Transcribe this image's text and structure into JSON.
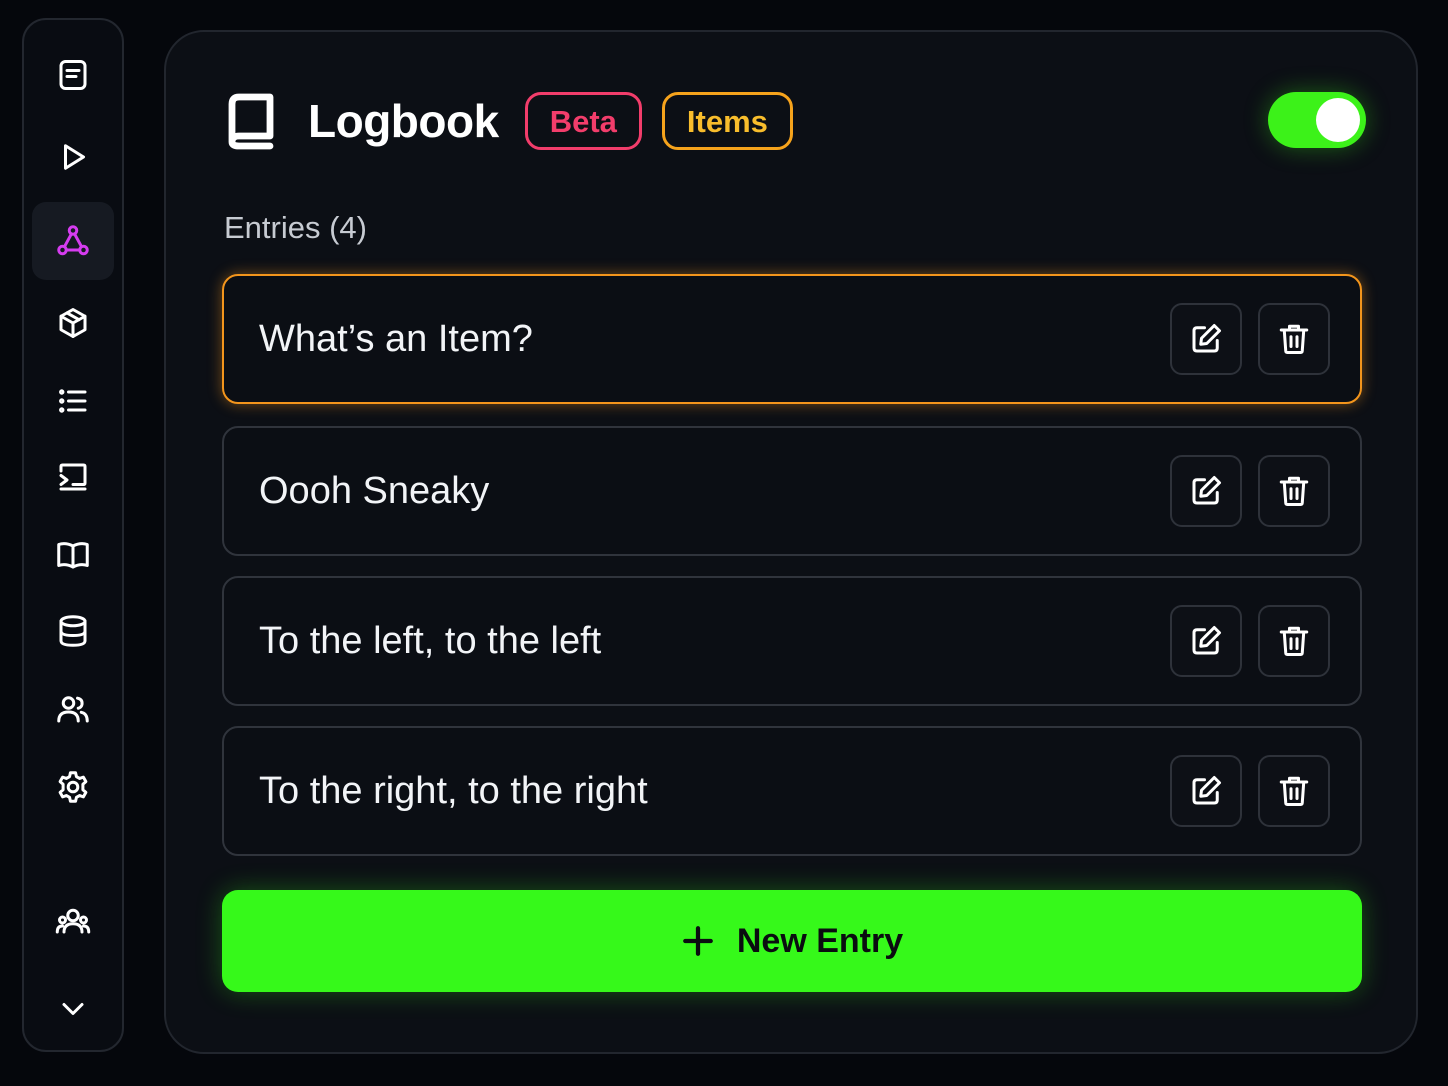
{
  "sidebar": {
    "items": [
      {
        "icon": "notes-icon",
        "active": false
      },
      {
        "icon": "play-icon",
        "active": false
      },
      {
        "icon": "nodes-icon",
        "active": true
      },
      {
        "icon": "cube-icon",
        "active": false
      },
      {
        "icon": "list-icon",
        "active": false
      },
      {
        "icon": "terminal-screen-icon",
        "active": false
      },
      {
        "icon": "open-book-icon",
        "active": false
      },
      {
        "icon": "database-icon",
        "active": false
      },
      {
        "icon": "users-icon",
        "active": false
      },
      {
        "icon": "gear-icon",
        "active": false
      }
    ],
    "bottom": [
      {
        "icon": "users-icon"
      },
      {
        "icon": "chevron-down-icon"
      }
    ],
    "active_color": "#d63cf0"
  },
  "header": {
    "title": "Logbook",
    "badges": [
      {
        "label": "Beta",
        "color": "#f23d6b"
      },
      {
        "label": "Items",
        "color": "#f6a31c"
      }
    ],
    "toggle_on": true,
    "toggle_color": "#3cf219"
  },
  "entries": {
    "label": "Entries (4)",
    "items": [
      {
        "text": "What’s an Item?",
        "selected": true
      },
      {
        "text": "Oooh Sneaky",
        "selected": false
      },
      {
        "text": "To the left, to the left",
        "selected": false
      },
      {
        "text": "To the right, to the right",
        "selected": false
      }
    ],
    "selected_color": "#f3951c"
  },
  "new_entry": {
    "label": "New Entry",
    "color": "#36f91a"
  }
}
